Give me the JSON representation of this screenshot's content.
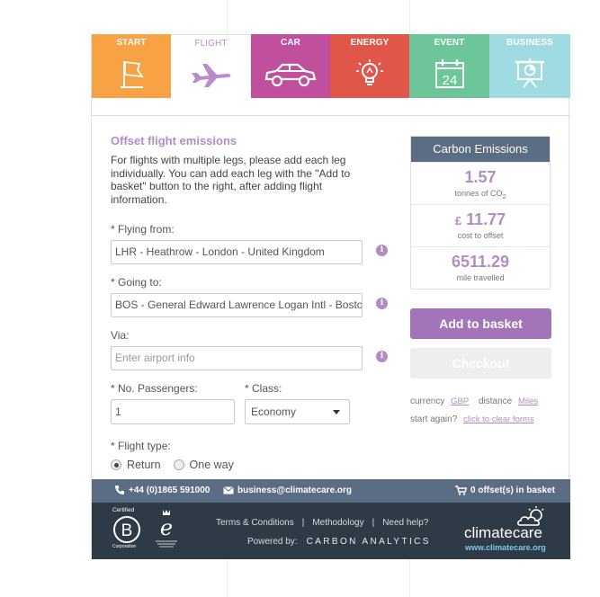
{
  "tabs": [
    {
      "label": "START",
      "icon": "flag-icon"
    },
    {
      "label": "FLIGHT",
      "icon": "airplane-icon",
      "active": true
    },
    {
      "label": "CAR",
      "icon": "car-icon"
    },
    {
      "label": "ENERGY",
      "icon": "lightbulb-icon"
    },
    {
      "label": "EVENT",
      "icon": "calendar-icon",
      "calendar_day": "24"
    },
    {
      "label": "BUSINESS",
      "icon": "presentation-chart-icon"
    }
  ],
  "form": {
    "title": "Offset flight emissions",
    "intro": "For flights with multiple legs, please add each leg individually. You can add each leg with the \"Add to basket\" button to the right, after adding flight information.",
    "from_label": "* Flying from:",
    "from_value": "LHR - Heathrow - London - United Kingdom",
    "to_label": "* Going to:",
    "to_value": "BOS - General Edward Lawrence Logan Intl - Boston",
    "via_label": "Via:",
    "via_placeholder": "Enter airport info",
    "passengers_label": "* No. Passengers:",
    "passengers_value": "1",
    "class_label": "* Class:",
    "class_value": "Economy",
    "flight_type_label": "* Flight type:",
    "flight_type_options": [
      "Return",
      "One way"
    ],
    "flight_type_selected": "Return",
    "info_glyph": "i"
  },
  "emissions": {
    "title": "Carbon Emissions",
    "tonnes_value": "1.57",
    "tonnes_label": "tonnes of CO",
    "tonnes_label_sub": "2",
    "cost_currency": "£",
    "cost_value": "11.77",
    "cost_label": "cost to offset",
    "miles_value": "6511.29",
    "miles_label": "mile travelled"
  },
  "actions": {
    "add_to_basket": "Add to basket",
    "checkout": "Checkout"
  },
  "settings": {
    "currency_label": "currency",
    "currency_value": "GBP",
    "distance_label": "distance",
    "distance_value": "Miles",
    "start_again_label": "start again?",
    "clear_forms_link": "click to clear forms"
  },
  "contact": {
    "phone": "+44 (0)1865 591000",
    "email": "business@climatecare.org",
    "basket": "0 offset(s) in basket"
  },
  "footer": {
    "bcorp_certified": "Certified",
    "bcorp_name": "Corporation",
    "terms": "Terms & Conditions",
    "methodology": "Methodology",
    "help": "Need help?",
    "separator": "|",
    "powered_by": "Powered by:",
    "carbon_analytics": "CARBON ANALYTICS",
    "brand": "climatecare",
    "brand_url": "www.climatecare.org"
  },
  "colors": {
    "start": "#f7a244",
    "car": "#c04f9e",
    "energy": "#e0574a",
    "event": "#6cc69a",
    "business": "#9fdbe0",
    "accent": "#b48cc3",
    "slate": "#5a6d82",
    "footer": "#2f3a47"
  }
}
